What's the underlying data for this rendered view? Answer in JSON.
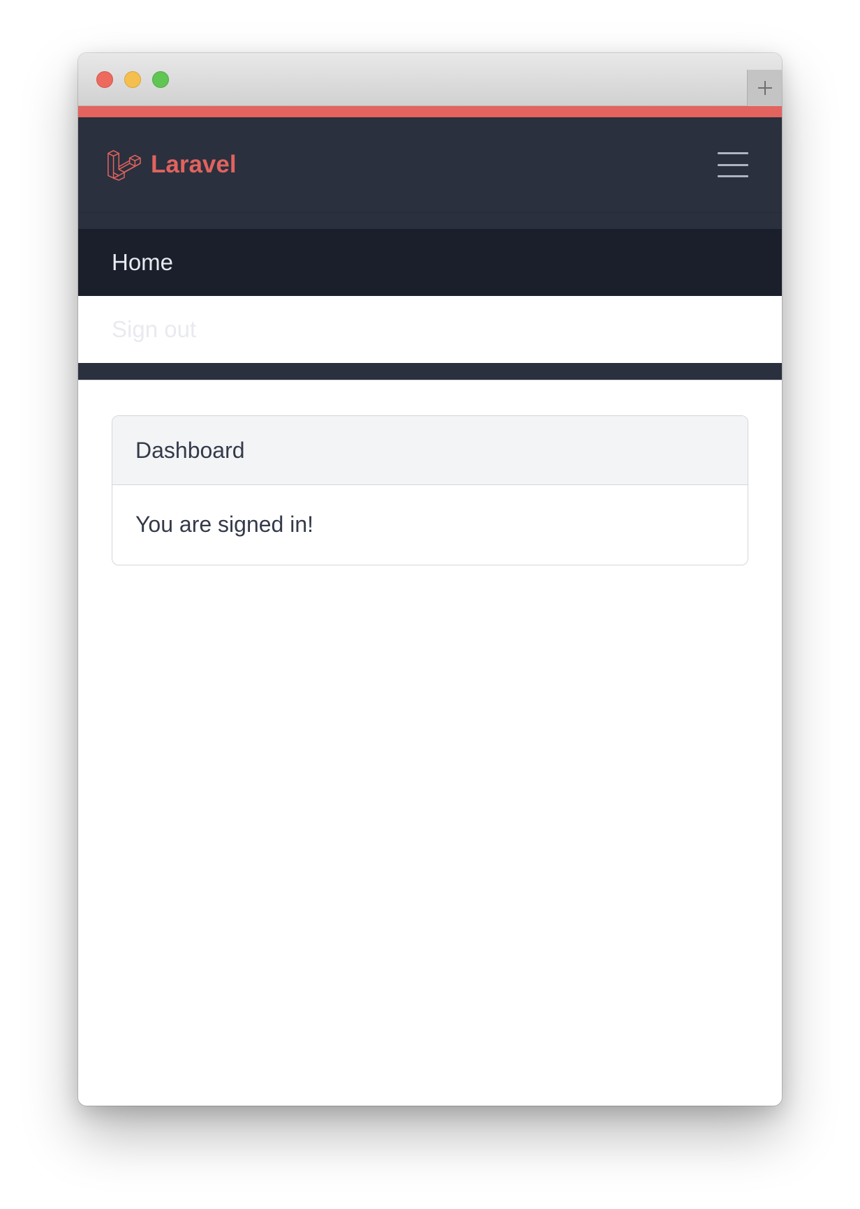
{
  "window": {
    "controls": [
      "close",
      "minimize",
      "zoom"
    ],
    "new_tab_icon": "plus-icon"
  },
  "navbar": {
    "brand": "Laravel",
    "brand_icon": "laravel-logo-icon",
    "menu_icon": "hamburger-menu-icon",
    "items": [
      {
        "label": "Home",
        "active": true
      },
      {
        "label": "Sign out",
        "active": false
      }
    ]
  },
  "card": {
    "header": "Dashboard",
    "body": "You are signed in!"
  },
  "colors": {
    "accent": "#e3635f",
    "navbar_bg": "#2a303e",
    "active_item_bg": "#1b1f2c",
    "brand": "#e0635e"
  }
}
